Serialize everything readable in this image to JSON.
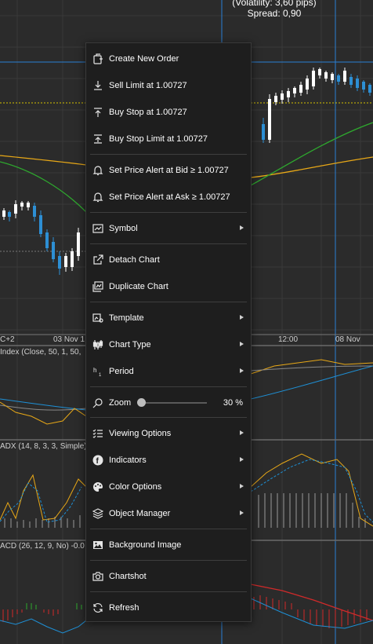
{
  "header": {
    "volatility": "(Volatility: 3,60 pips)",
    "spread": "Spread: 0,90"
  },
  "time_axis": [
    "C+2",
    "03 Nov 1",
    "12:00",
    "08 Nov"
  ],
  "indicators": {
    "index": "Index (Close, 50, 1, 50,",
    "adx": "ADX (14, 8, 3, 3, Simple)",
    "macd": "ACD (26, 12, 9, No) -0.0"
  },
  "menu": {
    "items": [
      {
        "icon": "new-order-icon",
        "label": "Create New Order"
      },
      {
        "icon": "sell-limit-icon",
        "label": "Sell Limit at 1.00727"
      },
      {
        "icon": "buy-stop-icon",
        "label": "Buy Stop at 1.00727"
      },
      {
        "icon": "buy-stop-limit-icon",
        "label": "Buy Stop Limit at 1.00727"
      },
      {
        "icon": "bell-icon",
        "label": "Set Price Alert at Bid ≥ 1.00727"
      },
      {
        "icon": "bell-icon",
        "label": "Set Price Alert at Ask ≥ 1.00727"
      },
      {
        "icon": "symbol-icon",
        "label": "Symbol",
        "submenu": true
      },
      {
        "icon": "detach-icon",
        "label": "Detach Chart"
      },
      {
        "icon": "duplicate-icon",
        "label": "Duplicate Chart"
      },
      {
        "icon": "template-icon",
        "label": "Template",
        "submenu": true
      },
      {
        "icon": "candlestick-icon",
        "label": "Chart Type",
        "submenu": true
      },
      {
        "icon": "period-icon",
        "label": "Period",
        "submenu": true
      },
      {
        "icon": "zoom-icon",
        "label": "Zoom",
        "value": "30 %",
        "level": 0.0
      },
      {
        "icon": "viewing-options-icon",
        "label": "Viewing Options",
        "submenu": true
      },
      {
        "icon": "indicators-icon",
        "label": "Indicators",
        "submenu": true
      },
      {
        "icon": "palette-icon",
        "label": "Color Options",
        "submenu": true
      },
      {
        "icon": "layers-icon",
        "label": "Object Manager",
        "submenu": true
      },
      {
        "icon": "image-icon",
        "label": "Background Image"
      },
      {
        "icon": "camera-icon",
        "label": "Chartshot"
      },
      {
        "icon": "refresh-icon",
        "label": "Refresh"
      }
    ]
  },
  "colors": {
    "background": "#2b2b2b",
    "menu_bg": "#1e1e1e",
    "bull": "#ffffff",
    "bear": "#2d8fd4",
    "ma_yellow": "#e8a817",
    "ma_green": "#2ea82e",
    "price_line": "#ffd700"
  }
}
